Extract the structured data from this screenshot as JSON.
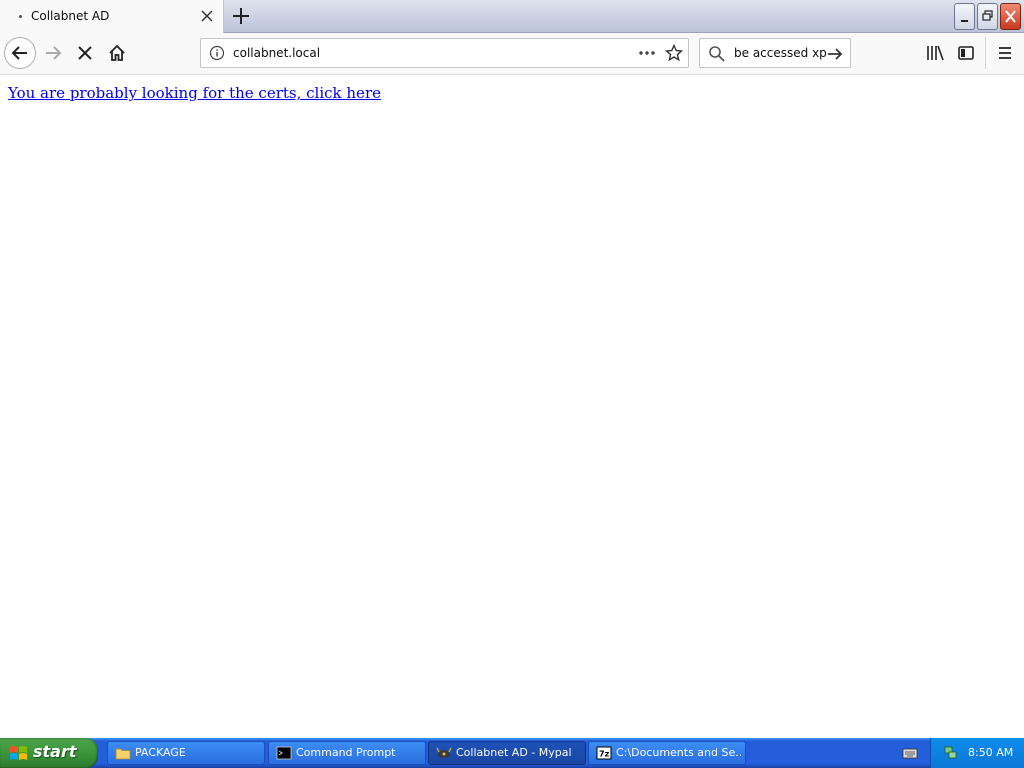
{
  "tab": {
    "title": "Collabnet AD"
  },
  "navbar": {
    "url": "collabnet.local",
    "search_value": "be accessed xp"
  },
  "content": {
    "link_text": "You are probably looking for the certs, click here"
  },
  "taskbar": {
    "start_label": "start",
    "items": [
      {
        "label": "PACKAGE",
        "icon": "folder-icon",
        "active": false
      },
      {
        "label": "Command Prompt",
        "icon": "cmd-icon",
        "active": false
      },
      {
        "label": "Collabnet AD - Mypal",
        "icon": "mypal-icon",
        "active": true
      },
      {
        "label": "C:\\Documents and Se...",
        "icon": "7zip-icon",
        "active": false
      }
    ],
    "clock": "8:50 AM"
  },
  "colors": {
    "accent": "#0a84ff",
    "link": "#0000ee",
    "taskbar": "#245edb",
    "start": "#3b953b"
  }
}
